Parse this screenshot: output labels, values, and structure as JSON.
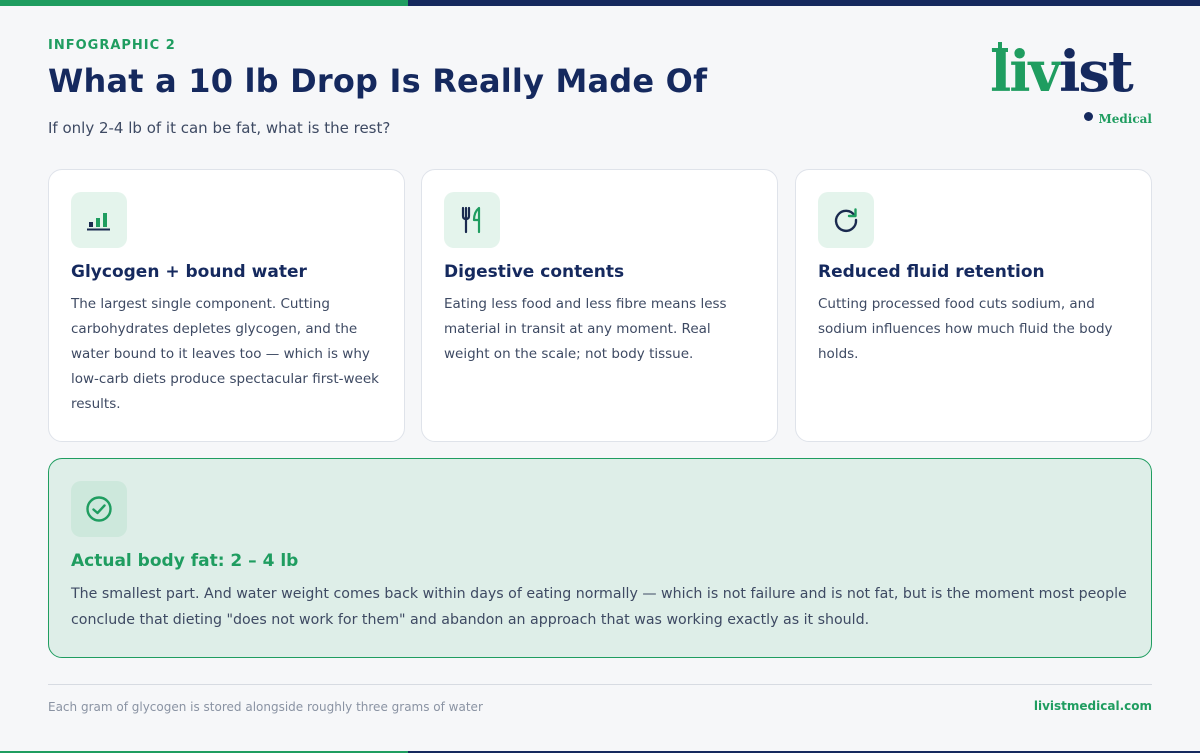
{
  "header": {
    "eyebrow": "INFOGRAPHIC 2",
    "title": "What a 10 lb Drop Is Really Made Of",
    "subtitle": "If only 2-4 lb of it can be fat, what is the rest?"
  },
  "logo": {
    "word_green": "liv",
    "word_navy": "ist",
    "sub": "Medical"
  },
  "cards": [
    {
      "icon": "bar-chart-icon",
      "title": "Glycogen + bound water",
      "text": "The largest single component. Cutting carbohydrates depletes glycogen, and the water bound to it leaves too — which is why low-carb diets produce spectacular first-week results."
    },
    {
      "icon": "fork-knife-icon",
      "title": "Digestive contents",
      "text": "Eating less food and less fibre means less material in transit at any moment. Real weight on the scale; not body tissue."
    },
    {
      "icon": "refresh-icon",
      "title": "Reduced fluid retention",
      "text": "Cutting processed food cuts sodium, and sodium influences how much fluid the body holds."
    }
  ],
  "callout": {
    "icon": "check-circle-icon",
    "title": "Actual body fat: 2 – 4 lb",
    "text": "The smallest part. And water weight comes back within days of eating normally — which is not failure and is not fat, but is the moment most people conclude that dieting \"does not work for them\" and abandon an approach that was working exactly as it should."
  },
  "footer": {
    "note": "Each gram of glycogen is stored alongside roughly three grams of water",
    "link": "livistmedical.com"
  },
  "colors": {
    "green": "#1f9d60",
    "navy": "#15295e",
    "callout_bg": "#deeee8"
  }
}
